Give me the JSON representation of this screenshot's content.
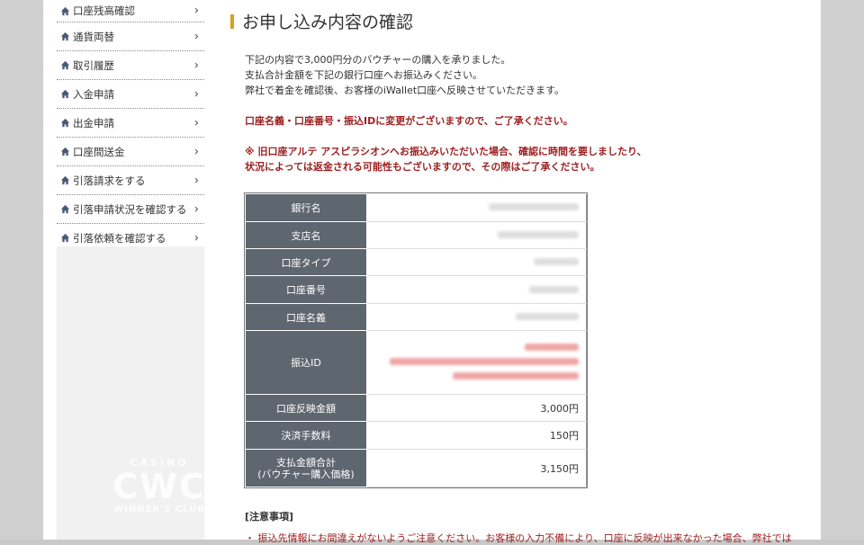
{
  "sidebar": {
    "items": [
      {
        "label": "口座残高確認"
      },
      {
        "label": "通貨両替"
      },
      {
        "label": "取引履歴"
      },
      {
        "label": "入金申請"
      },
      {
        "label": "出金申請"
      },
      {
        "label": "口座間送金"
      },
      {
        "label": "引落請求をする"
      },
      {
        "label": "引落申請状況を確認する"
      },
      {
        "label": "引落依頼を確認する"
      }
    ]
  },
  "main": {
    "title": "お申し込み内容の確認",
    "intro": [
      "下記の内容で3,000円分のバウチャーの購入を承りました。",
      "支払合計金額を下記の銀行口座へお振込みください。",
      "弊社で着金を確認後、お客様のiWallet口座へ反映させていただきます。"
    ],
    "notice1": "口座名義・口座番号・振込IDに変更がございますので、ご了承ください。",
    "notice2": [
      "※ 旧口座アルテ アスピラシオンへお振込みいただいた場合、確認に時間を要しましたり、",
      "状況によっては返金される可能性もございますので、その際はご了承ください。"
    ],
    "table": {
      "bank_name": "銀行名",
      "branch_name": "支店名",
      "account_type": "口座タイプ",
      "account_number": "口座番号",
      "account_holder": "口座名義",
      "transfer_id": "振込ID",
      "reflect_amount_label": "口座反映金額",
      "reflect_amount": "3,000円",
      "fee_label": "決済手数料",
      "fee": "150円",
      "total_label_1": "支払金額合計",
      "total_label_2": "(バウチャー購入価格)",
      "total": "3,150円"
    },
    "notes_title": "[注意事項]",
    "notes_line": "・ 振込先情報にお間違えがないようご注意ください。お客様の入力不備により、口座に反映が出来なかった場合、弊社では"
  },
  "watermark": {
    "casino": "CASINO",
    "brand": "CWC",
    "club": "WINNER'S CLUB"
  },
  "colors": {
    "accent": "#d6a21b",
    "notice": "#9c1f1f",
    "table_header": "#5e6670"
  }
}
